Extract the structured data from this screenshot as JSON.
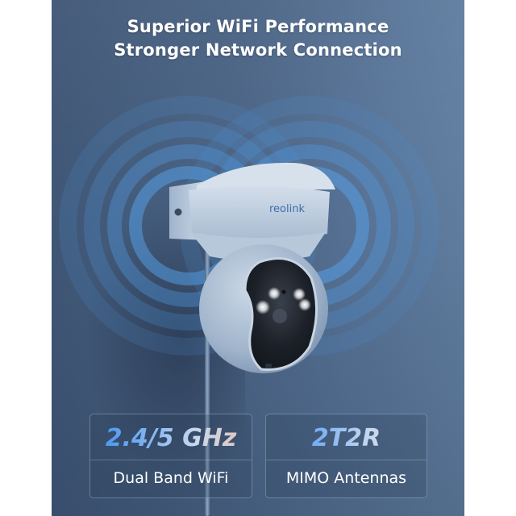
{
  "headline": {
    "line1": "Superior WiFi Performance",
    "line2": "Stronger Network Connection"
  },
  "product": {
    "brand_logo_text": "reolink",
    "type": "PTZ WiFi security camera",
    "icons": [
      "wifi-waves-left-icon",
      "wifi-waves-right-icon"
    ]
  },
  "features": [
    {
      "value": "2.4/5 GHz",
      "label": "Dual Band WiFi"
    },
    {
      "value": "2T2R",
      "label": "MIMO Antennas"
    }
  ],
  "colors": {
    "background": "#4b6485",
    "wave": "#4f9be8",
    "value_gradient_start": "#3d8ef0",
    "value_gradient_end": "#e9c4b5",
    "text": "#ffffff"
  }
}
